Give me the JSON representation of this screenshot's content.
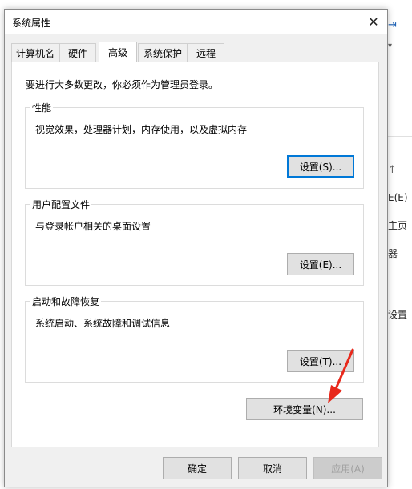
{
  "dialog": {
    "title": "系统属性",
    "close_symbol": "✕",
    "tabs": [
      "计算机名",
      "硬件",
      "高级",
      "系统保护",
      "远程"
    ],
    "admin_note": "要进行大多数更改，你必须作为管理员登录。",
    "performance": {
      "label": "性能",
      "description": "视觉效果，处理器计划，内存使用，以及虚拟内存",
      "settings_button": "设置(S)..."
    },
    "user_profiles": {
      "label": "用户配置文件",
      "description": "与登录帐户相关的桌面设置",
      "settings_button": "设置(E)..."
    },
    "startup_recovery": {
      "label": "启动和故障恢复",
      "description": "系统启动、系统故障和调试信息",
      "settings_button": "设置(T)..."
    },
    "env_vars_button": "环境变量(N)...",
    "ok_button": "确定",
    "cancel_button": "取消",
    "apply_button": "应用(A)"
  },
  "background_window": {
    "top_fragments": [
      "\\u2020",
      "\\u201c"
    ],
    "right_texts": [
      "E",
      "\\u2191",
      "E(E)",
      "主页",
      "器",
      "设置"
    ]
  },
  "colors": {
    "focus_border": "#0078d7",
    "annotation_arrow": "#e8291c"
  }
}
